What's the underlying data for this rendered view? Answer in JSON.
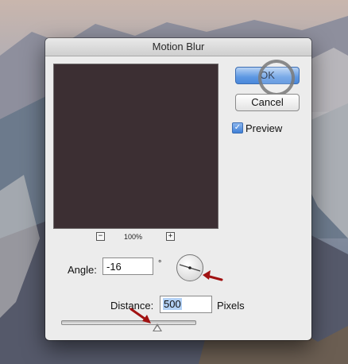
{
  "dialog": {
    "title": "Motion Blur",
    "ok_label": "OK",
    "cancel_label": "Cancel",
    "preview": {
      "label": "Preview",
      "checked": true
    },
    "zoom": {
      "minus": "−",
      "plus": "+",
      "level": "100%"
    },
    "angle": {
      "label": "Angle:",
      "value": "-16",
      "unit": "°"
    },
    "distance": {
      "label": "Distance:",
      "value": "500",
      "unit_label": "Pixels"
    }
  },
  "colors": {
    "preview_fill": "#3c2f33",
    "accent": "#4a88db",
    "annotation_arrow": "#a11212"
  },
  "icons": [
    "angle-dial-icon",
    "annotation-arrow-icon",
    "zoom-out-icon",
    "zoom-in-icon",
    "checkbox-check-icon"
  ]
}
